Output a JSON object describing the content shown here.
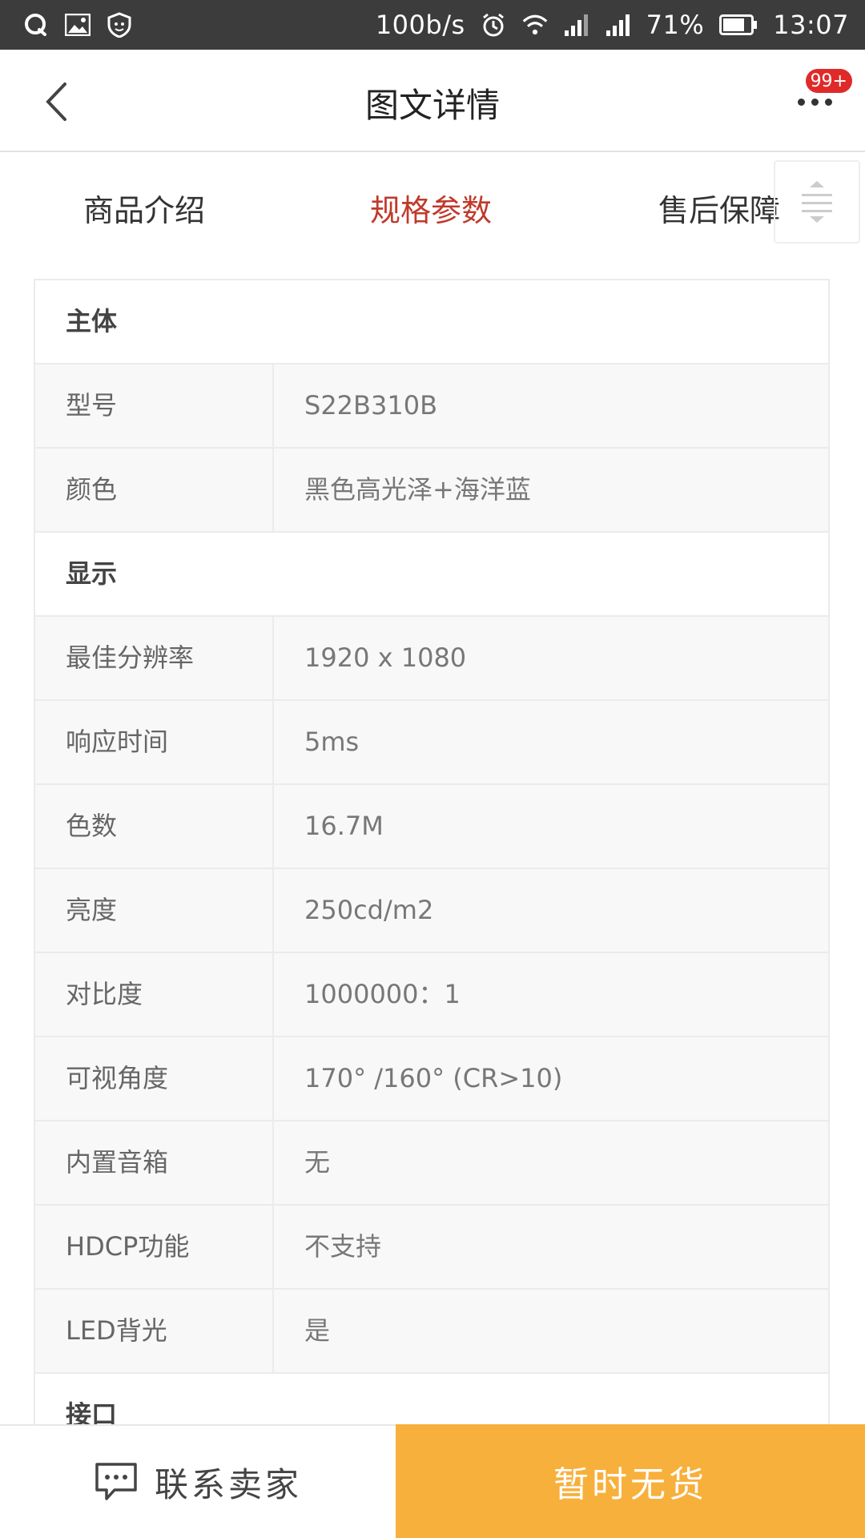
{
  "status_bar": {
    "net_speed": "100b/s",
    "battery_percent": "71%",
    "time": "13:07"
  },
  "header": {
    "title": "图文详情",
    "badge": "99+"
  },
  "tabs": [
    {
      "label": "商品介绍",
      "active": false
    },
    {
      "label": "规格参数",
      "active": true
    },
    {
      "label": "售后保障",
      "active": false
    }
  ],
  "specs": {
    "group_main": "主体",
    "model_key": "型号",
    "model_val": "S22B310B",
    "color_key": "颜色",
    "color_val": "黑色高光泽+海洋蓝",
    "group_display": "显示",
    "res_key": "最佳分辨率",
    "res_val": "1920 x 1080",
    "resp_key": "响应时间",
    "resp_val": "5ms",
    "colors_key": "色数",
    "colors_val": "16.7M",
    "bright_key": "亮度",
    "bright_val": "250cd/m2",
    "contrast_key": "对比度",
    "contrast_val": "1000000：1",
    "angle_key": "可视角度",
    "angle_val": "170° /160°  (CR>10)",
    "speaker_key": "内置音箱",
    "speaker_val": "无",
    "hdcp_key": "HDCP功能",
    "hdcp_val": "不支持",
    "led_key": "LED背光",
    "led_val": "是",
    "group_ports": "接口"
  },
  "bottom": {
    "contact_label": "联系卖家",
    "buy_label": "暂时无货"
  },
  "colors": {
    "active_tab": "#c0392b",
    "buy_button": "#f8b03c",
    "badge": "#e02a2a"
  }
}
